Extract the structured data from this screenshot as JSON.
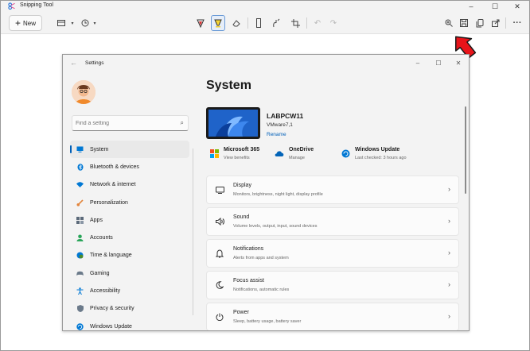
{
  "snipping_tool": {
    "title": "Snipping Tool",
    "new_label": "New",
    "window_controls": [
      "–",
      "☐",
      "✕"
    ]
  },
  "settings": {
    "title": "Settings",
    "search_placeholder": "Find a setting",
    "nav": [
      {
        "label": "System",
        "icon": "monitor-icon",
        "color": "#0078d4"
      },
      {
        "label": "Bluetooth & devices",
        "icon": "bluetooth-icon",
        "color": "#0078d4"
      },
      {
        "label": "Network & internet",
        "icon": "wifi-icon",
        "color": "#0078d4"
      },
      {
        "label": "Personalization",
        "icon": "brush-icon",
        "color": "#e3853c"
      },
      {
        "label": "Apps",
        "icon": "apps-icon",
        "color": "#5c6a7a"
      },
      {
        "label": "Accounts",
        "icon": "person-icon",
        "color": "#2aa55a"
      },
      {
        "label": "Time & language",
        "icon": "globe-clock-icon",
        "color": "#0078d4"
      },
      {
        "label": "Gaming",
        "icon": "gamepad-icon",
        "color": "#6b7a8a"
      },
      {
        "label": "Accessibility",
        "icon": "accessibility-icon",
        "color": "#0078d4"
      },
      {
        "label": "Privacy & security",
        "icon": "shield-icon",
        "color": "#6b7a8a"
      },
      {
        "label": "Windows Update",
        "icon": "update-icon",
        "color": "#0078d4"
      }
    ],
    "page_title": "System",
    "device": {
      "name": "LABPCW11",
      "model": "VMware7,1",
      "rename": "Rename"
    },
    "quick_links": [
      {
        "label": "Microsoft 365",
        "sub": "View benefits",
        "icon": "microsoft-365-icon"
      },
      {
        "label": "OneDrive",
        "sub": "Manage",
        "icon": "onedrive-icon"
      },
      {
        "label": "Windows Update",
        "sub": "Last checked: 3 hours ago",
        "icon": "windows-update-icon"
      }
    ],
    "cards": [
      {
        "title": "Display",
        "sub": "Monitors, brightness, night light, display profile",
        "icon": "display-icon"
      },
      {
        "title": "Sound",
        "sub": "Volume levels, output, input, sound devices",
        "icon": "speaker-icon"
      },
      {
        "title": "Notifications",
        "sub": "Alerts from apps and system",
        "icon": "bell-icon"
      },
      {
        "title": "Focus assist",
        "sub": "Notifications, automatic rules",
        "icon": "moon-icon"
      },
      {
        "title": "Power",
        "sub": "Sleep, battery usage, battery saver",
        "icon": "power-icon"
      }
    ]
  },
  "colors": {
    "accent": "#005fb8",
    "annotation_arrow": "#e8141a"
  }
}
